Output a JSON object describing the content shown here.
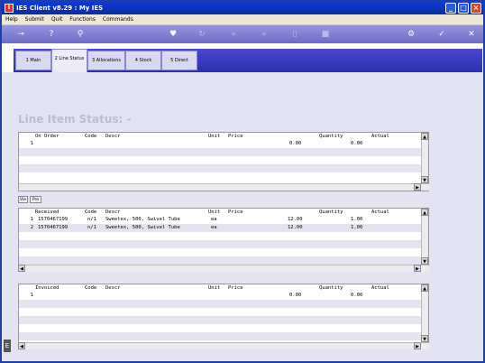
{
  "window": {
    "title": "IES Client v8.29 : My IES"
  },
  "menu": [
    "Help",
    "Submit",
    "Quit",
    "Functions",
    "Commands"
  ],
  "tabs": [
    {
      "label": "1 Main",
      "active": false
    },
    {
      "label": "2 Line Status",
      "active": true
    },
    {
      "label": "3 Allocations",
      "active": false
    },
    {
      "label": "4 Stock",
      "active": false
    },
    {
      "label": "5 Direct",
      "active": false
    }
  ],
  "page_title": "Line Item Status: -",
  "grids": {
    "on_order": {
      "headers": [
        "On Order",
        "Code",
        "Descr",
        "Unit",
        "Price",
        "Quantity",
        "Actual"
      ],
      "rows": [
        {
          "n": "1",
          "id": "",
          "code": "",
          "descr": "",
          "unit": "",
          "price": "0.00",
          "qty": "0.00"
        }
      ]
    },
    "received": {
      "headers": [
        "Received",
        "Code",
        "Descr",
        "Unit",
        "Price",
        "Quantity",
        "Actual"
      ],
      "rows": [
        {
          "n": "1",
          "id": "1570467199",
          "code": "n/1",
          "descr": "Sweetex, 500, Swivel Tube",
          "unit": "ea",
          "price": "12.00",
          "qty": "1.00"
        },
        {
          "n": "2",
          "id": "1570467199",
          "code": "n/1",
          "descr": "Sweetex, 500, Swivel Tube",
          "unit": "ea",
          "price": "12.00",
          "qty": "1.00"
        }
      ]
    },
    "invoiced": {
      "headers": [
        "Invoiced",
        "Code",
        "Descr",
        "Unit",
        "Price",
        "Quantity",
        "Actual"
      ],
      "rows": [
        {
          "n": "1",
          "id": "",
          "code": "",
          "descr": "",
          "unit": "",
          "price": "0.00",
          "qty": "0.00"
        }
      ]
    }
  },
  "buttons": {
    "nav_a": "Vie",
    "nav_b": "Pre"
  },
  "colors": {
    "titlebar": "#0d3bd6",
    "toolbar": "#6b6bc6",
    "tabwell": "#2e2eb0",
    "content": "#e3e3f1"
  }
}
